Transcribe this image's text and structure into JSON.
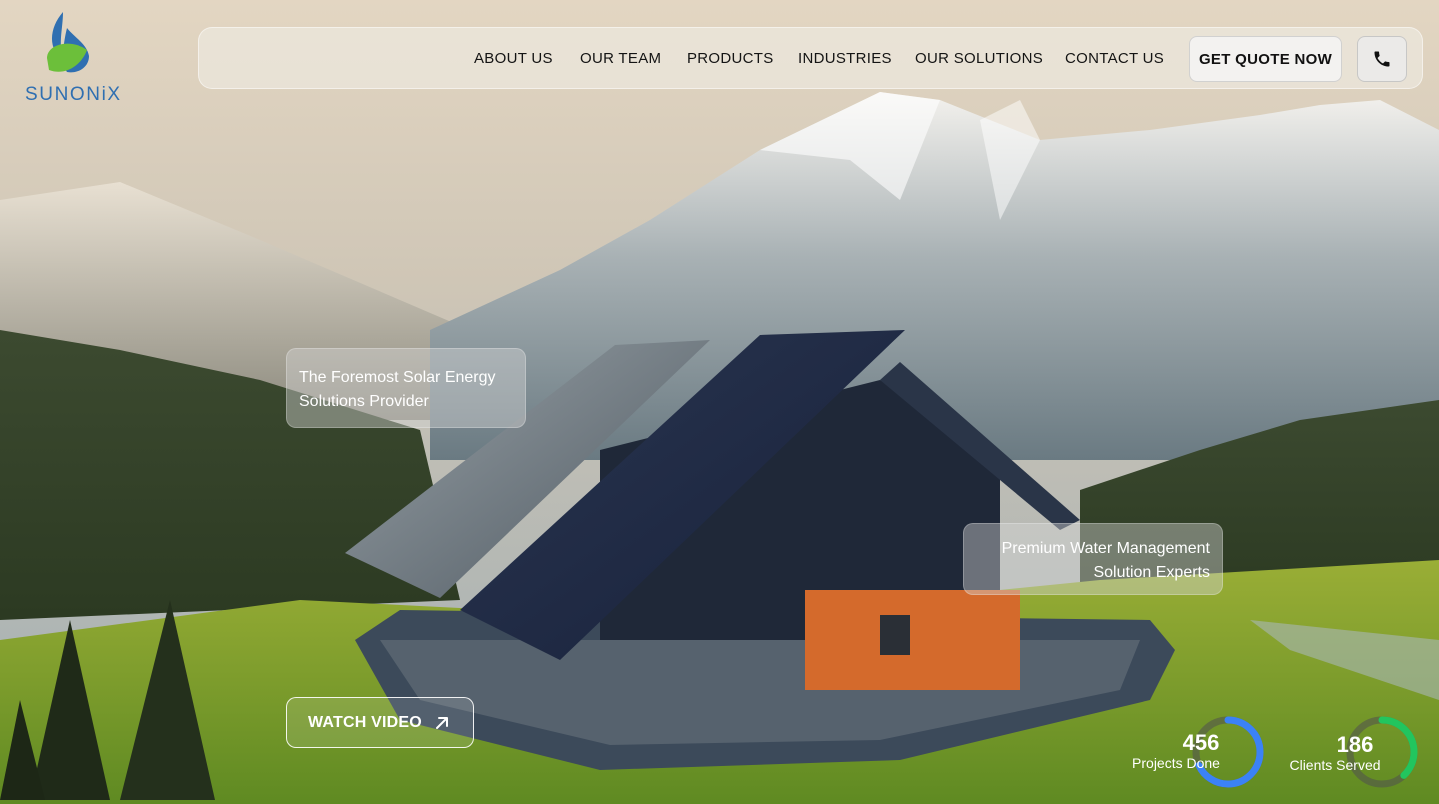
{
  "brand": {
    "name": "SUNONiX"
  },
  "nav": {
    "links": [
      "ABOUT US",
      "OUR TEAM",
      "PRODUCTS",
      "INDUSTRIES",
      "OUR SOLUTIONS",
      "CONTACT US"
    ],
    "quote_label": "GET QUOTE NOW",
    "phone_icon": "phone-icon"
  },
  "hero": {
    "card_left": {
      "line1": "The Foremost Solar Energy",
      "line2": "Solutions Provider"
    },
    "card_right": {
      "line1": "Premium Water Management",
      "line2": "Solution Experts"
    },
    "watch_label": "WATCH VIDEO",
    "watch_icon": "arrow-up-right-icon"
  },
  "stats": [
    {
      "value": "456",
      "label": "Projects Done",
      "ring_color": "#3b82f6",
      "progress": 0.68
    },
    {
      "value": "186",
      "label": "Clients Served",
      "ring_color": "#22c55e",
      "progress": 0.38
    }
  ],
  "colors": {
    "brand_blue": "#2f6fb1",
    "brand_green": "#6cbf3a"
  }
}
